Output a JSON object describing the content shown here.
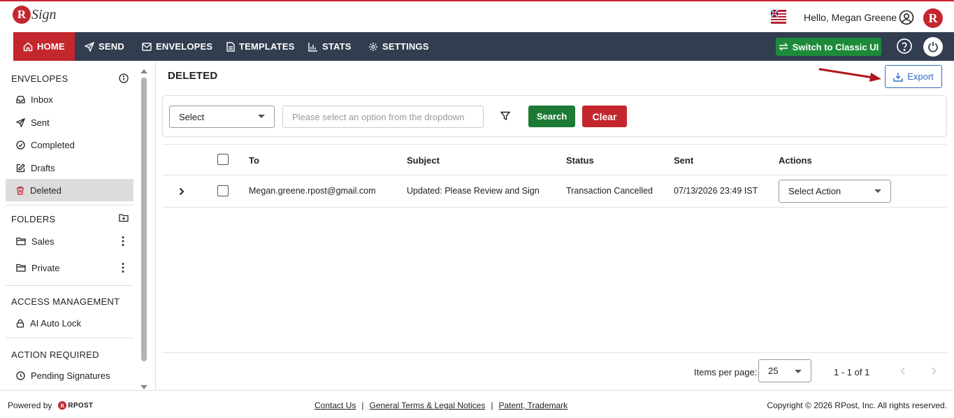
{
  "header": {
    "logo_letter": "R",
    "logo_text": "Sign",
    "greeting": "Hello, Megan Greene",
    "brand_letter": "R"
  },
  "nav": {
    "items": [
      {
        "label": "HOME",
        "icon": "home-icon",
        "active": true
      },
      {
        "label": "SEND",
        "icon": "send-icon"
      },
      {
        "label": "ENVELOPES",
        "icon": "envelope-icon"
      },
      {
        "label": "TEMPLATES",
        "icon": "document-icon"
      },
      {
        "label": "STATS",
        "icon": "bar-chart-icon"
      },
      {
        "label": "SETTINGS",
        "icon": "gear-icon"
      }
    ],
    "classic_label": "Switch to Classic UI"
  },
  "sidebar": {
    "envelopes_title": "ENVELOPES",
    "envelopes": [
      {
        "label": "Inbox",
        "icon": "inbox-icon"
      },
      {
        "label": "Sent",
        "icon": "send-icon"
      },
      {
        "label": "Completed",
        "icon": "check-circle-icon"
      },
      {
        "label": "Drafts",
        "icon": "edit-icon"
      },
      {
        "label": "Deleted",
        "icon": "trash-icon",
        "active": true
      }
    ],
    "folders_title": "FOLDERS",
    "folders": [
      {
        "label": "Sales",
        "icon": "folder-icon"
      },
      {
        "label": "Private",
        "icon": "folder-icon"
      }
    ],
    "access_title": "ACCESS MANAGEMENT",
    "access": [
      {
        "label": "AI Auto Lock",
        "icon": "lock-icon"
      }
    ],
    "action_title": "ACTION REQUIRED",
    "action": [
      {
        "label": "Pending Signatures",
        "icon": "clock-icon"
      }
    ]
  },
  "main": {
    "title": "DELETED",
    "export_label": "Export",
    "filter": {
      "select_value": "Select",
      "placeholder": "Please select an option from the dropdown",
      "search_label": "Search",
      "clear_label": "Clear"
    },
    "table": {
      "headers": {
        "to": "To",
        "subject": "Subject",
        "status": "Status",
        "sent": "Sent",
        "actions": "Actions"
      },
      "rows": [
        {
          "to": "Megan.greene.rpost@gmail.com",
          "subject": "Updated: Please Review and Sign",
          "status": "Transaction Cancelled",
          "sent": "07/13/2026 23:49 IST",
          "action": "Select Action"
        }
      ]
    },
    "pager": {
      "items_label": "Items per page:",
      "page_size": "25",
      "range": "1 - 1 of 1"
    }
  },
  "footer": {
    "powered": "Powered by",
    "rpost_letter": "R",
    "rpost_text": "RPOST",
    "links": [
      "Contact Us",
      "General Terms & Legal Notices",
      "Patent, Trademark"
    ],
    "separator": "|",
    "copyright": "Copyright © 2026 RPost, Inc. All rights reserved."
  },
  "colors": {
    "brand_red": "#c4262e",
    "nav_bg": "#323d4f",
    "green": "#1d7a35",
    "blue": "#2f6fc4"
  }
}
